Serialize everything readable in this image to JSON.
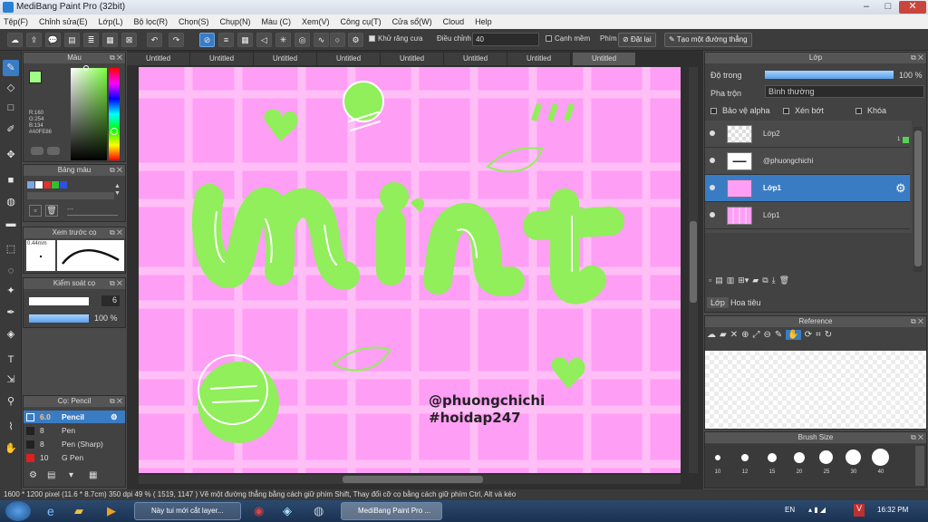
{
  "window": {
    "title": "MediBang Paint Pro (32bit)"
  },
  "menu": [
    "Tệp(F)",
    "Chỉnh sửa(E)",
    "Lớp(L)",
    "Bộ lọc(R)",
    "Chọn(S)",
    "Chụp(N)",
    "Màu (C)",
    "Xem(V)",
    "Công cụ(T)",
    "Cửa sổ(W)",
    "Cloud",
    "Help"
  ],
  "toolbar": {
    "antialias_label": "Khử răng cưa",
    "adjust_label": "Điều chỉnh",
    "adjust_value": "40",
    "edge_label": "Cạnh mềm",
    "key_label": "Phím",
    "reset_label": "Đặt lại",
    "line_label": "Tạo một đường thẳng"
  },
  "color_panel": {
    "title": "Màu",
    "rgb": [
      "R:160",
      "G:254",
      "B:134"
    ],
    "hex": "#A0FE86",
    "primary": "#a0fe86",
    "secondary": "#ffffff"
  },
  "palette_panel": {
    "title": "Bảng màu",
    "swatches": [
      "#7ea6e0",
      "#ffffff",
      "#e03030",
      "#30c030",
      "#3050e0"
    ]
  },
  "preview_panel": {
    "title": "Xem trước cọ",
    "size": "0.44mm"
  },
  "brush_control": {
    "title": "Kiểm soát cọ",
    "size_value": "6",
    "opacity_value": "100 %"
  },
  "brush_list": {
    "title": "Cọ: Pencil",
    "items": [
      {
        "size": "6.0",
        "name": "Pencil",
        "color": "#3a7cc4"
      },
      {
        "size": "8",
        "name": "Pen",
        "color": "#222222"
      },
      {
        "size": "8",
        "name": "Pen (Sharp)",
        "color": "#222222"
      },
      {
        "size": "10",
        "name": "G Pen",
        "color": "#e02020"
      }
    ]
  },
  "tabs": [
    "Untitled",
    "Untitled",
    "Untitled",
    "Untitled",
    "Untitled",
    "Untitled",
    "Untitled",
    "Untitled"
  ],
  "artwork": {
    "main_text": "mint",
    "handle": "@phuongchichi",
    "hashtag": "#hoidap247",
    "bg": "#ff9ef5",
    "accent": "#90ef5a"
  },
  "layer_panel": {
    "title": "Lớp",
    "opacity_label": "Độ trong",
    "opacity_value": "100 %",
    "blend_label": "Pha trộn",
    "blend_value": "Bình thường",
    "protect_alpha": "Bảo vệ alpha",
    "clipping": "Xén bớt",
    "lock": "Khóa",
    "layers": [
      {
        "name": "Lớp2",
        "badge": "1"
      },
      {
        "name": "@phuongchichi"
      },
      {
        "name": "Lớp1"
      },
      {
        "name": "Lớp1"
      }
    ],
    "tab_layer": "Lớp",
    "tab_nav": "Hoa tiêu"
  },
  "reference_panel": {
    "title": "Reference"
  },
  "brush_size_panel": {
    "title": "Brush Size",
    "sizes": [
      "10",
      "12",
      "15",
      "20",
      "25",
      "30",
      "40"
    ]
  },
  "status": {
    "size": "1600 * 1200 pixel",
    "cm": "(11.6 * 8.7cm)",
    "dpi": "350 dpi",
    "zoom": "49 %",
    "coords": "( 1519, 1147 )",
    "hint": "Vẽ một đường thẳng bằng cách giữ phím Shift, Thay đổi cỡ cọ bằng cách giữ phím Ctrl, Alt và kéo"
  },
  "taskbar": {
    "task1": "Này tui mới cắt layer...",
    "task2": "MediBang Paint Pro ...",
    "lang": "EN",
    "time": "16:32 PM"
  }
}
